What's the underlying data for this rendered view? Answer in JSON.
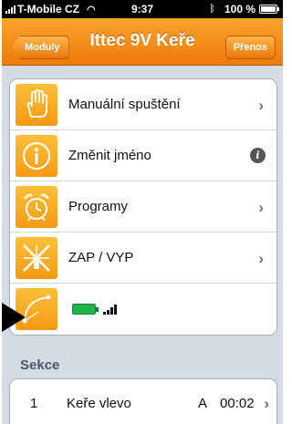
{
  "status_bar": {
    "carrier": "T-Mobile CZ",
    "time": "9:37",
    "battery": "100 %"
  },
  "nav": {
    "back_label": "Moduly",
    "title": "Ittec 9V Keře",
    "right_label": "Přenos"
  },
  "menu": [
    {
      "label": "Manuální spuštění",
      "icon": "hand-icon",
      "accessory": "chevron"
    },
    {
      "label": "Změnit jméno",
      "icon": "info-icon",
      "accessory": "info"
    },
    {
      "label": "Programy",
      "icon": "alarm-clock-icon",
      "accessory": "chevron"
    },
    {
      "label": "ZAP / VYP",
      "icon": "sprinkler-off-icon",
      "accessory": "chevron"
    }
  ],
  "status_row": {
    "icon": "connection-curve-icon",
    "battery_level": 1.0,
    "signal_bars_filled": 4
  },
  "section": {
    "title": "Sekce",
    "rows": [
      {
        "number": "1",
        "name": "Keře vlevo",
        "letter": "A",
        "time": "00:02"
      }
    ]
  },
  "colors": {
    "accent": "#f28c1a",
    "tile": "#f7a823",
    "battery_green": "#22b24a"
  }
}
